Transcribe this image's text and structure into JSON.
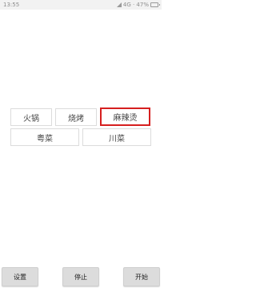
{
  "status_bar": {
    "time": "13:55",
    "right_text": "4G · 47%"
  },
  "tags": [
    {
      "label": "火锅",
      "selected": false
    },
    {
      "label": "烧烤",
      "selected": false
    },
    {
      "label": "麻辣烫",
      "selected": true
    },
    {
      "label": "粤菜",
      "selected": false
    },
    {
      "label": "川菜",
      "selected": false
    }
  ],
  "buttons": {
    "settings": "设置",
    "stop": "停止",
    "start": "开始"
  },
  "colors": {
    "selected_border": "#d61f1f",
    "button_bg": "#dcdcdc"
  },
  "icons": {
    "signal": "signal-icon",
    "battery": "battery-icon"
  }
}
